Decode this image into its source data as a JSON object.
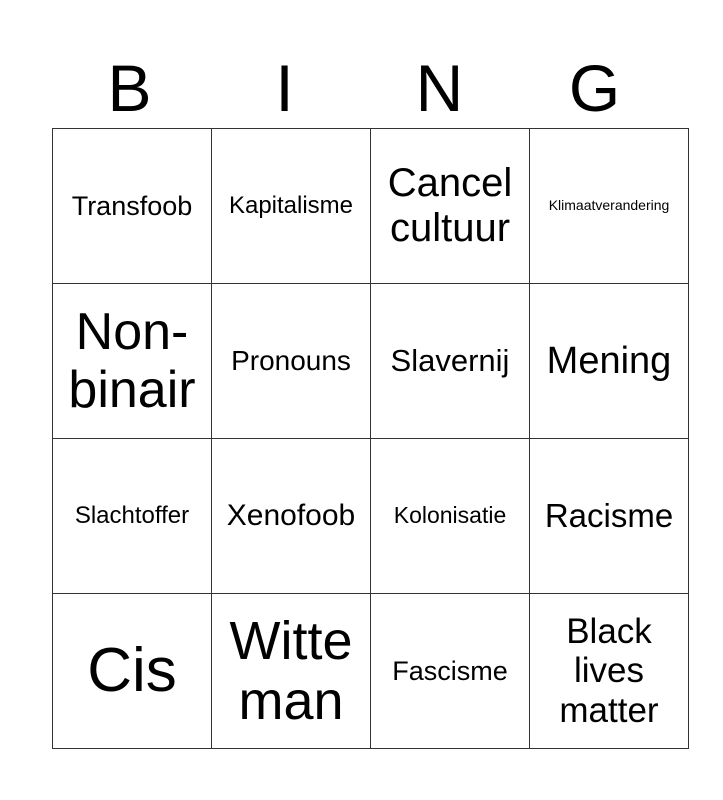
{
  "header": [
    "B",
    "I",
    "N",
    "G"
  ],
  "cells": [
    [
      {
        "text": "Transfoob",
        "size": 27
      },
      {
        "text": "Kapitalisme",
        "size": 24
      },
      {
        "text": "Cancel cultuur",
        "size": 40
      },
      {
        "text": "Klimaatverandering",
        "size": 14
      }
    ],
    [
      {
        "text": "Non-binair",
        "size": 52
      },
      {
        "text": "Pronouns",
        "size": 28
      },
      {
        "text": "Slavernij",
        "size": 31
      },
      {
        "text": "Mening",
        "size": 38
      }
    ],
    [
      {
        "text": "Slachtoffer",
        "size": 24
      },
      {
        "text": "Xenofoob",
        "size": 30
      },
      {
        "text": "Kolonisatie",
        "size": 23
      },
      {
        "text": "Racisme",
        "size": 33
      }
    ],
    [
      {
        "text": "Cis",
        "size": 62
      },
      {
        "text": "Witte man",
        "size": 54
      },
      {
        "text": "Fascisme",
        "size": 27
      },
      {
        "text": "Black lives matter",
        "size": 35
      }
    ]
  ]
}
